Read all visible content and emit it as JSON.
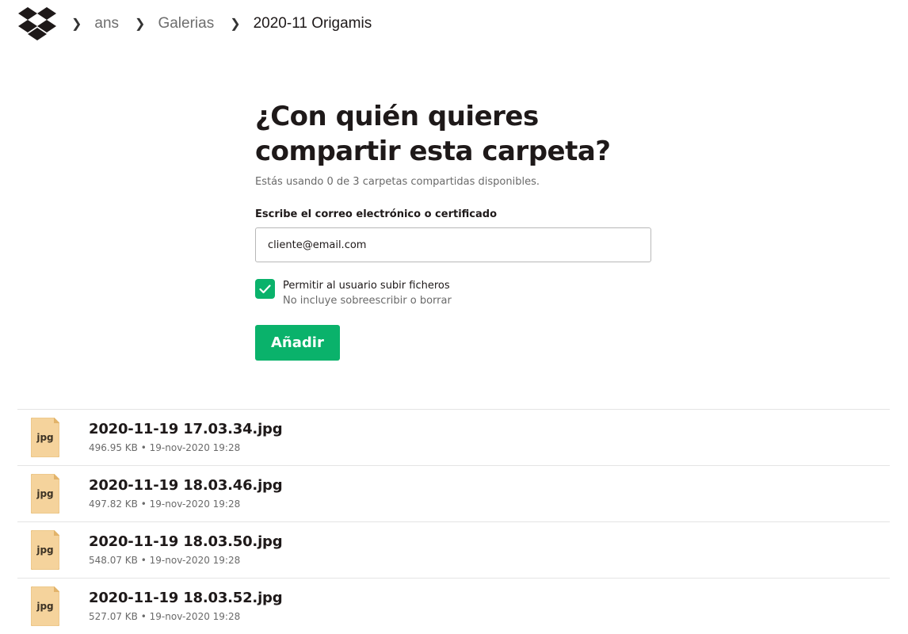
{
  "breadcrumb": {
    "items": [
      {
        "label": "ans"
      },
      {
        "label": "Galerias"
      },
      {
        "label": "2020-11 Origamis"
      }
    ]
  },
  "share": {
    "title_line1": "¿Con quién quieres",
    "title_line2": "compartir esta carpeta?",
    "usage": "Estás usando 0 de 3 carpetas compartidas disponibles.",
    "email_label": "Escribe el correo electrónico o certificado",
    "email_value": "cliente@email.com",
    "allow_upload_label": "Permitir al usuario subir ficheros",
    "allow_upload_hint": "No incluye sobreescribir o borrar",
    "allow_upload_checked": true,
    "add_button": "Añadir"
  },
  "files": [
    {
      "name": "2020-11-19 17.03.34.jpg",
      "size": "496.95 KB",
      "date": "19-nov-2020 19:28",
      "icon_label": "jpg"
    },
    {
      "name": "2020-11-19 18.03.46.jpg",
      "size": "497.82 KB",
      "date": "19-nov-2020 19:28",
      "icon_label": "jpg"
    },
    {
      "name": "2020-11-19 18.03.50.jpg",
      "size": "548.07 KB",
      "date": "19-nov-2020 19:28",
      "icon_label": "jpg"
    },
    {
      "name": "2020-11-19 18.03.52.jpg",
      "size": "527.07 KB",
      "date": "19-nov-2020 19:28",
      "icon_label": "jpg"
    }
  ],
  "meta_separator": "•",
  "colors": {
    "accent": "#0ab26b",
    "logo": "#1e1919",
    "file_icon": "#f5d39c"
  }
}
